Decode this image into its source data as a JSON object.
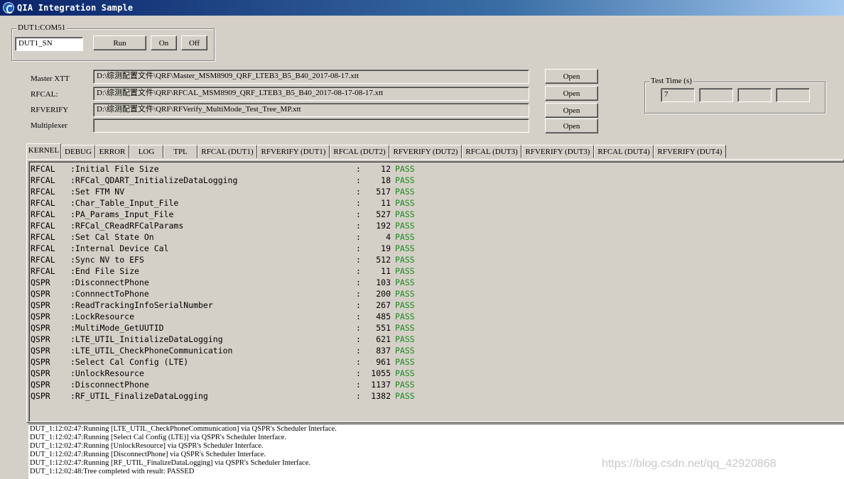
{
  "window": {
    "title": "QIA Integration Sample"
  },
  "dut_group": {
    "legend": "DUT1:COM51",
    "serial_value": "DUT1_SN",
    "run_label": "Run",
    "on_label": "On",
    "off_label": "Off"
  },
  "files": [
    {
      "label": "Master XTT",
      "path": "D:\\综测配置文件\\QRF\\Master_MSM8909_QRF_LTEB3_B5_B40_2017-08-17.xtt",
      "button": "Open"
    },
    {
      "label": "RFCAL:",
      "path": "D:\\综测配置文件\\QRF\\RFCAL_MSM8909_QRF_LTEB3_B5_B40_2017-08-17-08-17.xtt",
      "button": "Open"
    },
    {
      "label": "RFVERIFY",
      "path": "D:\\综测配置文件\\QRF\\RFVerify_MultiMode_Test_Tree_MP.xtt",
      "button": "Open"
    },
    {
      "label": "Multiplexer",
      "path": "",
      "button": "Open"
    }
  ],
  "test_time": {
    "legend": "Test Time (s)",
    "values": [
      "7",
      "",
      "",
      ""
    ]
  },
  "tabs": [
    "KERNEL",
    "DEBUG",
    "ERROR",
    "LOG",
    "TPL",
    "RFCAL (DUT1)",
    "RFVERIFY (DUT1)",
    "RFCAL (DUT2)",
    "RFVERIFY (DUT2)",
    "RFCAL (DUT3)",
    "RFVERIFY (DUT3)",
    "RFCAL (DUT4)",
    "RFVERIFY (DUT4)"
  ],
  "kernel_rows": [
    {
      "module": "RFCAL",
      "name": ":Initial File Size",
      "ms": "12",
      "result": "PASS"
    },
    {
      "module": "RFCAL",
      "name": ":RFCal_QDART_InitializeDataLogging",
      "ms": "18",
      "result": "PASS"
    },
    {
      "module": "RFCAL",
      "name": ":Set FTM NV",
      "ms": "517",
      "result": "PASS"
    },
    {
      "module": "RFCAL",
      "name": ":Char_Table_Input_File",
      "ms": "11",
      "result": "PASS"
    },
    {
      "module": "RFCAL",
      "name": ":PA_Params_Input_File",
      "ms": "527",
      "result": "PASS"
    },
    {
      "module": "RFCAL",
      "name": ":RFCal_CReadRFCalParams",
      "ms": "192",
      "result": "PASS"
    },
    {
      "module": "RFCAL",
      "name": ":Set Cal State On",
      "ms": "4",
      "result": "PASS"
    },
    {
      "module": "RFCAL",
      "name": ":Internal Device Cal",
      "ms": "19",
      "result": "PASS"
    },
    {
      "module": "RFCAL",
      "name": ":Sync NV to EFS",
      "ms": "512",
      "result": "PASS"
    },
    {
      "module": "RFCAL",
      "name": ":End File Size",
      "ms": "11",
      "result": "PASS"
    },
    {
      "module": "QSPR",
      "name": ":DisconnectPhone",
      "ms": "103",
      "result": "PASS"
    },
    {
      "module": "QSPR",
      "name": ":ConnnectToPhone",
      "ms": "200",
      "result": "PASS"
    },
    {
      "module": "QSPR",
      "name": ":ReadTrackingInfoSerialNumber",
      "ms": "267",
      "result": "PASS"
    },
    {
      "module": "QSPR",
      "name": ":LockResource",
      "ms": "485",
      "result": "PASS"
    },
    {
      "module": "QSPR",
      "name": ":MultiMode_GetUUTID",
      "ms": "551",
      "result": "PASS"
    },
    {
      "module": "QSPR",
      "name": ":LTE_UTIL_InitializeDataLogging",
      "ms": "621",
      "result": "PASS"
    },
    {
      "module": "QSPR",
      "name": ":LTE_UTIL_CheckPhoneCommunication",
      "ms": "837",
      "result": "PASS"
    },
    {
      "module": "QSPR",
      "name": ":Select Cal Config (LTE)",
      "ms": "961",
      "result": "PASS"
    },
    {
      "module": "QSPR",
      "name": ":UnlockResource",
      "ms": "1055",
      "result": "PASS"
    },
    {
      "module": "QSPR",
      "name": ":DisconnectPhone",
      "ms": "1137",
      "result": "PASS"
    },
    {
      "module": "QSPR",
      "name": ":RF_UTIL_FinalizeDataLogging",
      "ms": "1382",
      "result": "PASS"
    }
  ],
  "log_lines": [
    "DUT_1:12:02:47:Running [LTE_UTIL_CheckPhoneCommunication] via QSPR's Scheduler Interface.",
    "DUT_1:12:02:47:Running [Select Cal Config (LTE)] via QSPR's Scheduler Interface.",
    "DUT_1:12:02:47:Running [UnlockResource] via QSPR's Scheduler Interface.",
    "DUT_1:12:02:47:Running [DisconnectPhone] via QSPR's Scheduler Interface.",
    "DUT_1:12:02:47:Running [RF_UTIL_FinalizeDataLogging] via QSPR's Scheduler Interface.",
    "DUT_1:12:02:48:Tree completed with result: PASSED"
  ],
  "watermark": "https://blog.csdn.net/qq_42920868",
  "colors": {
    "title_bar": "#0a246a",
    "pass": "#1a8a1a",
    "face": "#d4d0c8"
  }
}
